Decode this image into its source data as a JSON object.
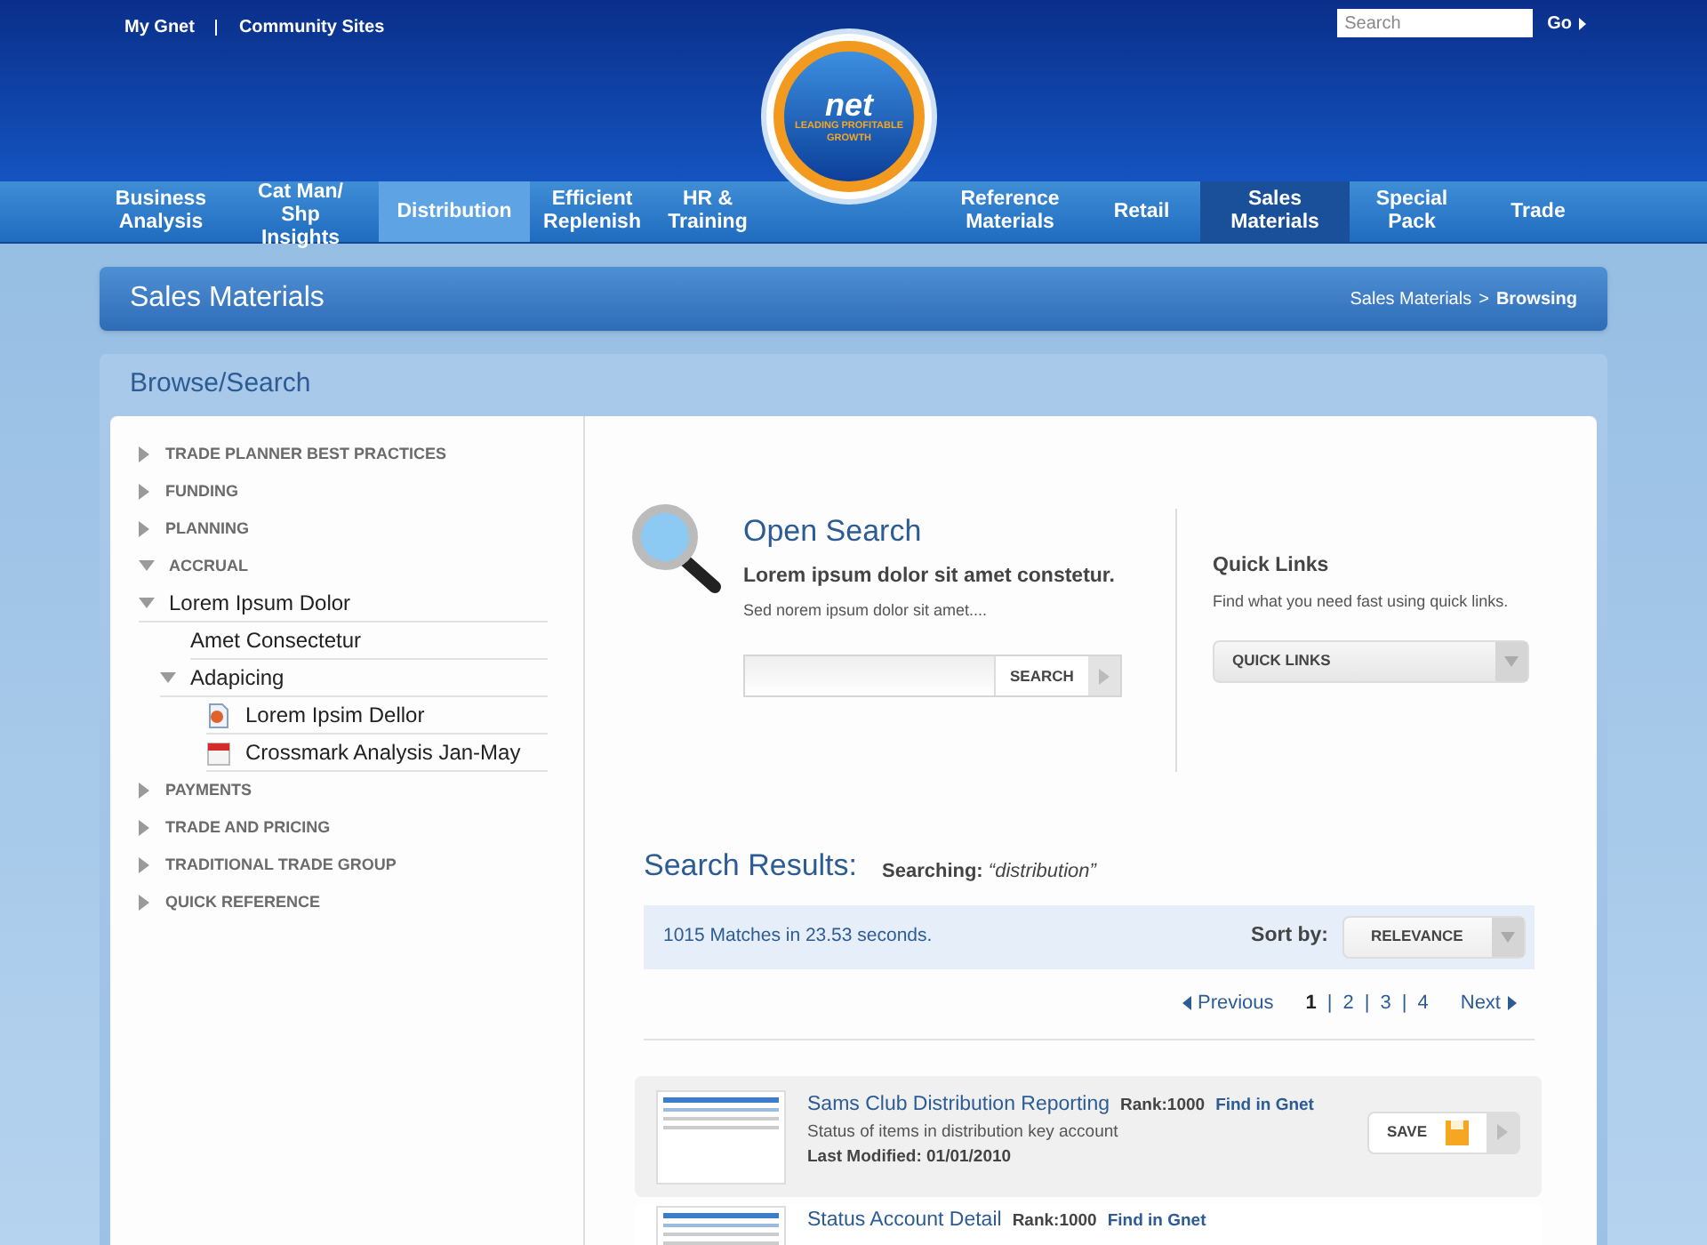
{
  "top_links": [
    "My Gnet",
    "Community Sites"
  ],
  "search": {
    "placeholder": "Search",
    "go": "Go"
  },
  "logo": {
    "mark": "net",
    "tagline": "LEADING PROFITABLE GROWTH"
  },
  "nav": [
    {
      "label": "Business Analysis",
      "selected": false,
      "hover": false
    },
    {
      "label": "Cat Man/ Shp Insights",
      "selected": false,
      "hover": false
    },
    {
      "label": "Distribution",
      "selected": false,
      "hover": true
    },
    {
      "label": "Efficient Replenish",
      "selected": false,
      "hover": false
    },
    {
      "label": "HR & Training",
      "selected": false,
      "hover": false
    },
    {
      "label": "Reference Materials",
      "selected": false,
      "hover": false
    },
    {
      "label": "Retail",
      "selected": false,
      "hover": false
    },
    {
      "label": "Sales Materials",
      "selected": true,
      "hover": false
    },
    {
      "label": "Special Pack",
      "selected": false,
      "hover": false
    },
    {
      "label": "Trade",
      "selected": false,
      "hover": false
    }
  ],
  "page_title": "Sales Materials",
  "breadcrumb": [
    {
      "label": "Sales Materials",
      "current": false
    },
    {
      "label": "Browsing",
      "current": true
    }
  ],
  "breadcrumb_separator": ">",
  "panel_title": "Browse/Search",
  "tree": [
    {
      "label": "TRADE PLANNER BEST PRACTICES",
      "kind": "section",
      "expanded": false
    },
    {
      "label": "FUNDING",
      "kind": "section",
      "expanded": false
    },
    {
      "label": "PLANNING",
      "kind": "section",
      "expanded": false
    },
    {
      "label": "ACCRUAL",
      "kind": "section",
      "expanded": true,
      "children": [
        {
          "label": "Lorem Ipsum Dolor",
          "kind": "folder",
          "expanded": true,
          "children": [
            {
              "label": "Amet Consectetur",
              "kind": "leaf"
            },
            {
              "label": "Adapicing",
              "kind": "folder",
              "expanded": true,
              "children": [
                {
                  "label": "Lorem Ipsim Dellor",
                  "kind": "presentation"
                },
                {
                  "label": "Crossmark Analysis Jan-May",
                  "kind": "calendar"
                }
              ]
            }
          ]
        }
      ]
    },
    {
      "label": "PAYMENTS",
      "kind": "section",
      "expanded": false
    },
    {
      "label": "TRADE AND PRICING",
      "kind": "section",
      "expanded": false
    },
    {
      "label": "TRADITIONAL TRADE GROUP",
      "kind": "section",
      "expanded": false
    },
    {
      "label": "QUICK REFERENCE",
      "kind": "section",
      "expanded": false
    }
  ],
  "open_search": {
    "title": "Open Search",
    "lead": "Lorem ipsum dolor sit amet constetur.",
    "sub": "Sed norem ipsum dolor sit amet....",
    "button": "SEARCH"
  },
  "quick_links": {
    "title": "Quick Links",
    "description": "Find what you need fast using quick links.",
    "dropdown": "QUICK LINKS"
  },
  "results": {
    "title": "Search Results:",
    "searching_label": "Searching:",
    "query": "“distribution”",
    "summary": "1015 Matches in 23.53 seconds.",
    "sort_label": "Sort by:",
    "sort_value": "RELEVANCE",
    "pagination": {
      "previous": "Previous",
      "next": "Next",
      "pages": [
        {
          "label": "1",
          "selected": true
        },
        {
          "label": "2",
          "selected": false
        },
        {
          "label": "3",
          "selected": false
        },
        {
          "label": "4",
          "selected": false
        }
      ],
      "separator": "|"
    },
    "items": [
      {
        "title": "Sams Club Distribution Reporting",
        "rank": "Rank:1000",
        "link": "Find in Gnet",
        "description": "Status of items in distribution key account",
        "modified": "Last Modified: 01/01/2010",
        "save": "SAVE",
        "highlighted": true
      },
      {
        "title": "Status Account Detail",
        "rank": "Rank:1000",
        "link": "Find in Gnet",
        "highlighted": false
      }
    ]
  }
}
